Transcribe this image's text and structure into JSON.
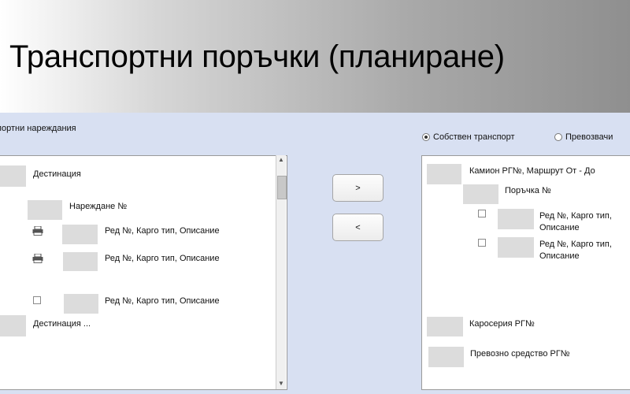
{
  "title": "Транспортни поръчки (планиране)",
  "left_panel": {
    "label": "портни нареждания",
    "items": [
      {
        "type": "destination",
        "label": "Дестинация"
      },
      {
        "type": "order",
        "label": "Нареждане №"
      },
      {
        "type": "row",
        "icon": "printer-icon",
        "label": "Ред №, Карго тип, Описание"
      },
      {
        "type": "row",
        "icon": "printer-icon",
        "label": "Ред №, Карго тип, Описание"
      },
      {
        "type": "row",
        "icon": "checkbox",
        "label": "Ред №, Карго тип, Описание"
      },
      {
        "type": "destination",
        "label": "Дестинация ..."
      }
    ]
  },
  "buttons": {
    "move_right": ">",
    "move_left": "<"
  },
  "right_panel": {
    "radio_own": "Собствен транспорт",
    "radio_carriers": "Превозвачи",
    "selected": "own",
    "items": [
      {
        "type": "truck",
        "label": "Камион РГ№, Маршрут От - До"
      },
      {
        "type": "order",
        "label": "Поръчка №"
      },
      {
        "type": "row",
        "label": "Ред №, Карго тип, Описание"
      },
      {
        "type": "row",
        "label": "Ред №, Карго тип, Описание"
      },
      {
        "type": "body",
        "label": "Каросерия РГ№"
      },
      {
        "type": "vehicle",
        "label": "Превозно средство РГ№"
      }
    ]
  }
}
